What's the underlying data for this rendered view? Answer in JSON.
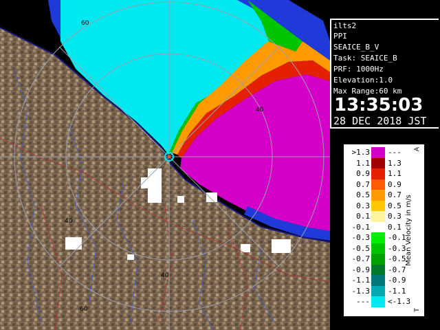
{
  "header": {
    "site": "ilts2",
    "product": "PPI",
    "product_name": "SEAICE_B_V",
    "task": "Task: SEAICE_B",
    "prf": "PRF: 1000Hz",
    "elevation": "Elevation:1.0",
    "max_range": "Max Range:60 km",
    "time": "13:35:03",
    "date": "28 DEC 2018 JST"
  },
  "range_labels": [
    "60",
    "40",
    "40",
    "40",
    "60"
  ],
  "legend": {
    "title": "Mean Velocity in m/s",
    "top_mark": "A",
    "bottom_mark": "T",
    "rows": [
      {
        "lo": ">1.3",
        "hi": "---",
        "color": "#d400c8"
      },
      {
        "lo": "1.1",
        "hi": "1.3",
        "color": "#a00000"
      },
      {
        "lo": "0.9",
        "hi": "1.1",
        "color": "#e42000"
      },
      {
        "lo": "0.7",
        "hi": "0.9",
        "color": "#ff5a00"
      },
      {
        "lo": "0.5",
        "hi": "0.7",
        "color": "#ff9a00"
      },
      {
        "lo": "0.3",
        "hi": "0.5",
        "color": "#ffc800"
      },
      {
        "lo": "0.1",
        "hi": "0.3",
        "color": "#fff5a0"
      },
      {
        "lo": "-0.1",
        "hi": "0.1",
        "color": "#ffffff"
      },
      {
        "lo": "-0.3",
        "hi": "-0.1",
        "color": "#00ee00"
      },
      {
        "lo": "-0.5",
        "hi": "-0.3",
        "color": "#00c400"
      },
      {
        "lo": "-0.7",
        "hi": "-0.5",
        "color": "#00a000"
      },
      {
        "lo": "-0.9",
        "hi": "-0.7",
        "color": "#007a2a"
      },
      {
        "lo": "-1.1",
        "hi": "-0.9",
        "color": "#00787a"
      },
      {
        "lo": "-1.3",
        "hi": "-1.1",
        "color": "#00aab0"
      },
      {
        "lo": "---",
        "hi": "<-1.3",
        "color": "#00e8f0"
      }
    ]
  },
  "colors": {
    "sea_ice_receding": "#d400c8",
    "sea_ice_approaching": "#00e8f0",
    "land": "#7a6650",
    "coastline": "#1a1a80",
    "range_rings": "#9aa0b0"
  }
}
